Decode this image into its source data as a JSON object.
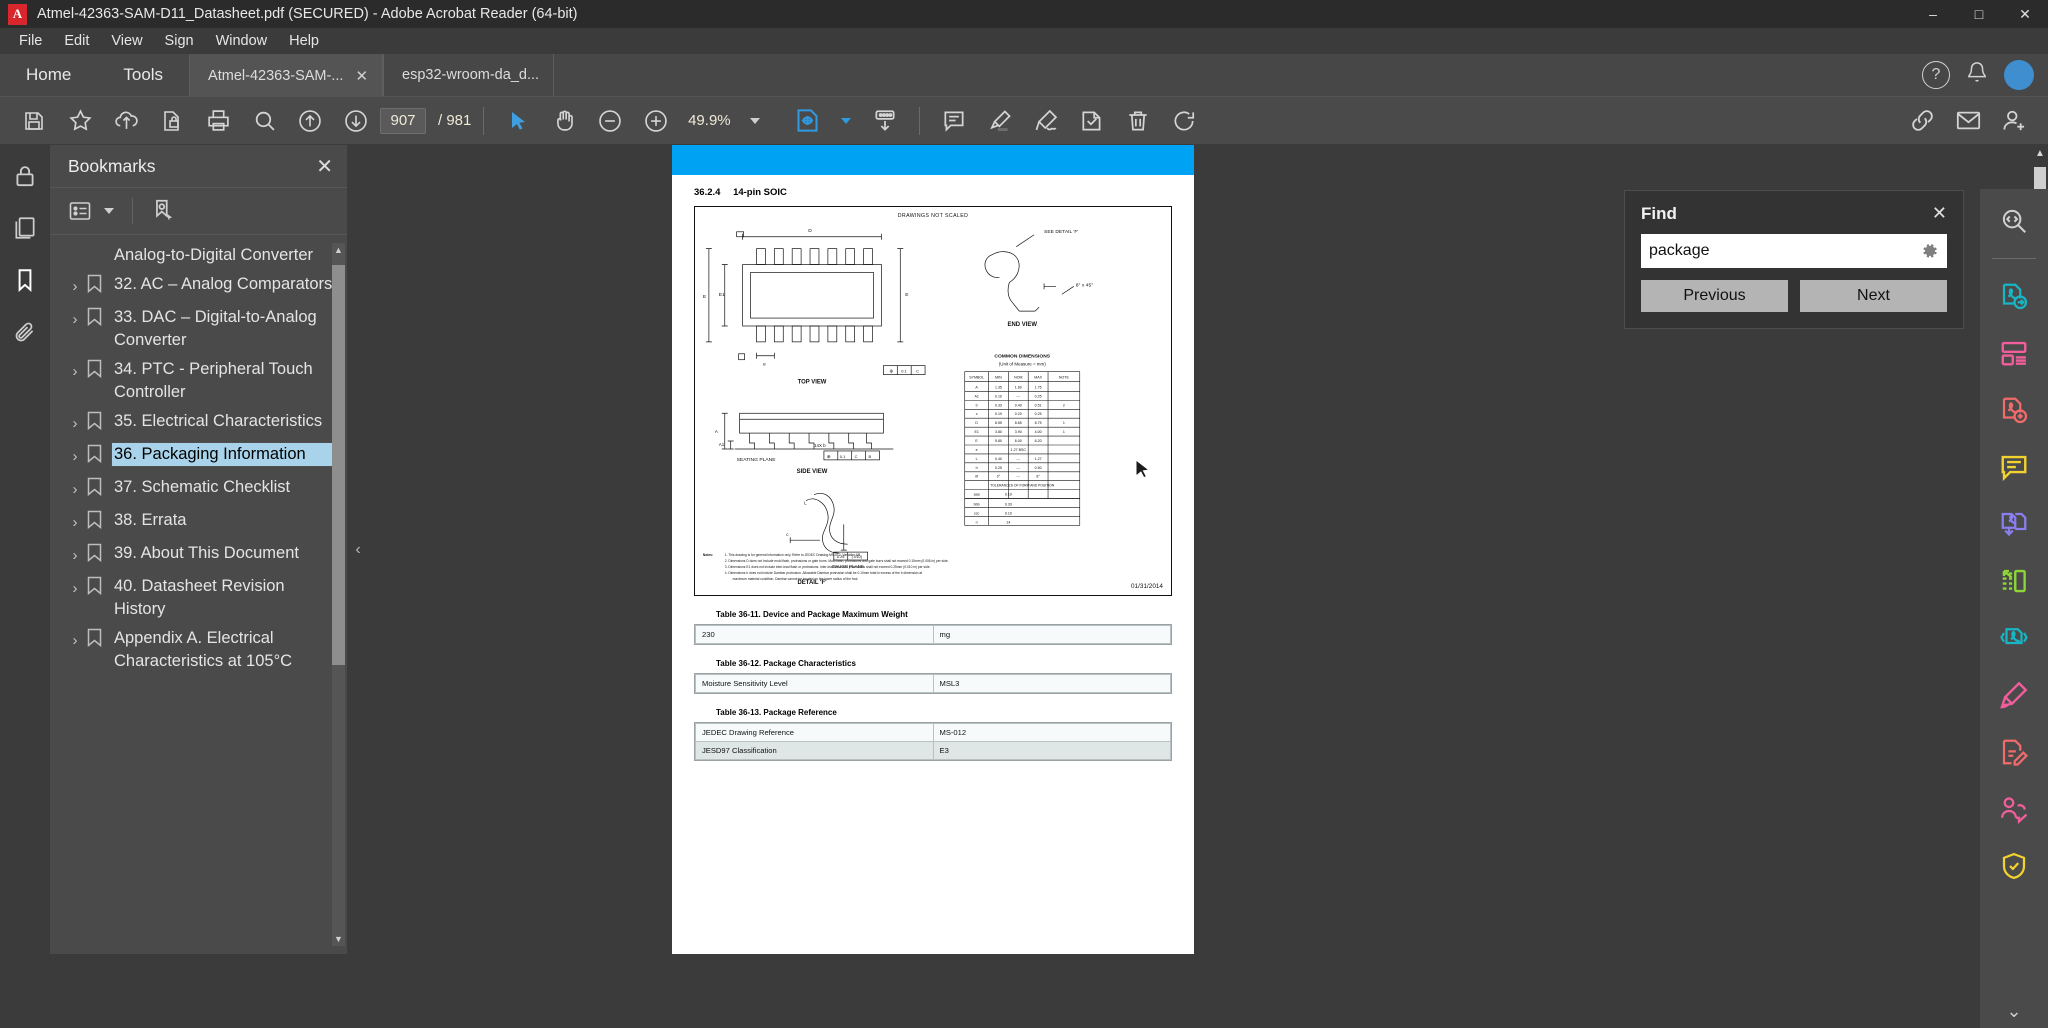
{
  "window": {
    "title": "Atmel-42363-SAM-D11_Datasheet.pdf (SECURED) - Adobe Acrobat Reader (64-bit)",
    "minimize": "–",
    "maximize": "□",
    "close": "✕"
  },
  "menubar": {
    "items": [
      "File",
      "Edit",
      "View",
      "Sign",
      "Window",
      "Help"
    ]
  },
  "tabbar": {
    "home": "Home",
    "tools": "Tools",
    "tabs": [
      {
        "label": "Atmel-42363-SAM-...",
        "close": "✕",
        "active": true
      },
      {
        "label": "esp32-wroom-da_d...",
        "close": "",
        "active": false
      }
    ],
    "help_icon": "?",
    "bell_icon": "bell-icon",
    "avatar_initial": ""
  },
  "toolbar": {
    "save_icon": "save-icon",
    "star_icon": "add-to-favorites-icon",
    "upload_icon": "upload-to-cloud-icon",
    "secure_icon": "document-security-icon",
    "print_icon": "print-icon",
    "search_icon": "search-icon",
    "prev_page_icon": "previous-page-icon",
    "next_page_icon": "next-page-icon",
    "page_current": "907",
    "page_separator": "/",
    "page_total": "981",
    "select_tool_icon": "select-cursor-icon",
    "hand_tool_icon": "hand-tool-icon",
    "zoom_out_icon": "zoom-out-icon",
    "zoom_in_icon": "zoom-in-icon",
    "zoom_level": "49.9%",
    "fit_icon": "fit-page-icon",
    "scroll_mode_icon": "page-scrolling-icon",
    "comment_icon": "add-comment-icon",
    "highlight_icon": "highlight-text-icon",
    "draw_icon": "draw-freehand-icon",
    "stamp_icon": "add-stamp-icon",
    "delete_icon": "delete-icon",
    "rotate_icon": "rotate-icon",
    "share_link_icon": "share-link-icon",
    "email_icon": "email-icon",
    "add_person_icon": "add-person-icon"
  },
  "left_rail": {
    "items": [
      {
        "icon": "lock-icon",
        "name": "security-panel"
      },
      {
        "icon": "pages-icon",
        "name": "page-thumbnails-panel"
      },
      {
        "icon": "bookmark-icon",
        "name": "bookmarks-panel",
        "active": true
      },
      {
        "icon": "attachment-icon",
        "name": "attachments-panel"
      }
    ]
  },
  "bookmarks": {
    "title": "Bookmarks",
    "close": "✕",
    "options_icon": "bookmark-options-icon",
    "options_caret": "▾",
    "new_bookmark_icon": "new-bookmark-icon",
    "items": [
      {
        "label": "Analog-to-Digital Converter",
        "expandable": false,
        "selected": false
      },
      {
        "label": "32. AC – Analog Comparators",
        "expandable": true,
        "selected": false
      },
      {
        "label": "33. DAC – Digital-to-Analog Converter",
        "expandable": true,
        "selected": false
      },
      {
        "label": "34. PTC - Peripheral Touch Controller",
        "expandable": true,
        "selected": false
      },
      {
        "label": "35. Electrical Characteristics",
        "expandable": true,
        "selected": false
      },
      {
        "label": "36. Packaging Information",
        "expandable": true,
        "selected": true
      },
      {
        "label": "37. Schematic Checklist",
        "expandable": true,
        "selected": false
      },
      {
        "label": "38. Errata",
        "expandable": true,
        "selected": false
      },
      {
        "label": "39. About This Document",
        "expandable": true,
        "selected": false
      },
      {
        "label": "40. Datasheet Revision History",
        "expandable": true,
        "selected": false
      },
      {
        "label": "Appendix A. Electrical Characteristics at 105°C",
        "expandable": true,
        "selected": false
      }
    ]
  },
  "document": {
    "section_number": "36.2.4",
    "section_title": "14-pin SOIC",
    "drawing_note": "DRAWINGS NOT SCALED",
    "date_stamp": "01/31/2014",
    "views": {
      "top": "TOP VIEW",
      "side": "SIDE VIEW",
      "end": "END VIEW",
      "detail": "DETAIL 'F'",
      "see_detail": "SEE DETAIL 'F'",
      "seating_plane": "SEATING PLANE",
      "gauge_plane": "GAUGE PLANE",
      "angle": "8° x 45°"
    },
    "dim_table": {
      "title": "COMMON DIMENSIONS",
      "subtitle": "(Unit of Measure = mm)",
      "headers": [
        "SYMBOL",
        "MIN",
        "NOM",
        "MAX",
        "NOTE"
      ],
      "rows": [
        [
          "A",
          "1.35",
          "1.60",
          "1.75",
          ""
        ],
        [
          "A1",
          "0.10",
          "---",
          "0.25",
          ""
        ],
        [
          "b",
          "0.33",
          "0.40",
          "0.51",
          "2"
        ],
        [
          "c",
          "0.19",
          "0.20",
          "0.25",
          ""
        ],
        [
          "D",
          "8.55",
          "8.65",
          "8.75",
          "1"
        ],
        [
          "E1",
          "3.80",
          "3.90",
          "4.00",
          "1"
        ],
        [
          "E",
          "5.80",
          "6.00",
          "6.20",
          ""
        ],
        [
          "e",
          "",
          "1.27 BSC",
          "",
          ""
        ],
        [
          "L",
          "0.40",
          "---",
          "1.27",
          ""
        ],
        [
          "h",
          "0.25",
          "---",
          "0.50",
          ""
        ],
        [
          "Ø",
          "0°",
          "---",
          "8°",
          ""
        ]
      ],
      "tolerance_header": "TOLERANCES OF FORM AND POSITION",
      "tolerance_rows": [
        [
          "aaa",
          "0.10"
        ],
        [
          "bbb",
          "0.33"
        ],
        [
          "ccc",
          "0.10"
        ],
        [
          "n",
          "14"
        ]
      ]
    },
    "notes_title": "Notes:",
    "notes": [
      "1. This drawing is for general information only. Refer to JEDEC Drawing MS-012, Variation AB.",
      "2. Dimensions D does not include mold flash, protrusions or gate burrs. Mold flash, protrusions and gate burrs shall not exceed 0.15mm (0.006in) per side.",
      "3. Dimensions E1 does not include inter-lead flash or protrusions. Inter-lead flash and protrusions shall not exceed 0.25mm (0.010 in) per side.",
      "4. Dimensions b does not include Dambar protrusion. Allowable Dambar protrusion shall be 0.10mm total in excess of the b dimension at maximum material condition. Dambar cannot be located on the lower radius of the foot."
    ],
    "tables": [
      {
        "caption": "Table 36-11. Device and Package Maximum Weight",
        "rows": [
          [
            "230",
            "mg"
          ]
        ]
      },
      {
        "caption": "Table 36-12. Package Characteristics",
        "rows": [
          [
            "Moisture Sensitivity Level",
            "MSL3"
          ]
        ]
      },
      {
        "caption": "Table 36-13. Package Reference",
        "rows": [
          [
            "JEDEC Drawing Reference",
            "MS-012"
          ],
          [
            "JESD97 Classification",
            "E3"
          ]
        ]
      }
    ]
  },
  "find": {
    "title": "Find",
    "close": "✕",
    "query": "package",
    "placeholder": "Find",
    "settings_icon": "gear-icon",
    "previous_label": "Previous",
    "next_label": "Next"
  },
  "right_rail": {
    "items": [
      {
        "name": "search-tool",
        "icon": "search-code-icon",
        "color": "#d0d0d0"
      },
      {
        "name": "export-pdf-tool",
        "icon": "export-pdf-icon",
        "color": "#18b6c4"
      },
      {
        "name": "organize-pages-tool",
        "icon": "organize-pages-icon",
        "color": "#f25e9c"
      },
      {
        "name": "create-pdf-tool",
        "icon": "create-pdf-icon",
        "color": "#f26b6b"
      },
      {
        "name": "comment-tool",
        "icon": "comment-bubble-icon",
        "color": "#f2d230"
      },
      {
        "name": "combine-files-tool",
        "icon": "combine-files-icon",
        "color": "#8a7ef0"
      },
      {
        "name": "crop-pages-tool",
        "icon": "crop-pages-icon",
        "color": "#8cd636"
      },
      {
        "name": "compress-pdf-tool",
        "icon": "compress-pdf-icon",
        "color": "#18b6c4"
      },
      {
        "name": "fill-sign-tool",
        "icon": "fill-and-sign-icon",
        "color": "#f25e9c"
      },
      {
        "name": "edit-pdf-tool",
        "icon": "edit-pdf-icon",
        "color": "#f26b6b"
      },
      {
        "name": "request-signatures-tool",
        "icon": "request-signatures-icon",
        "color": "#f25e9c"
      },
      {
        "name": "protect-tool",
        "icon": "protect-pdf-icon",
        "color": "#f2d230"
      }
    ],
    "more_caret": "⌄"
  },
  "colors": {
    "accent_blue": "#2f9ae0",
    "page_band": "#00a2f3",
    "selection": "#a8d3ea",
    "chrome_dark": "#3b3b3b",
    "toolbar": "#4a4a4a"
  }
}
